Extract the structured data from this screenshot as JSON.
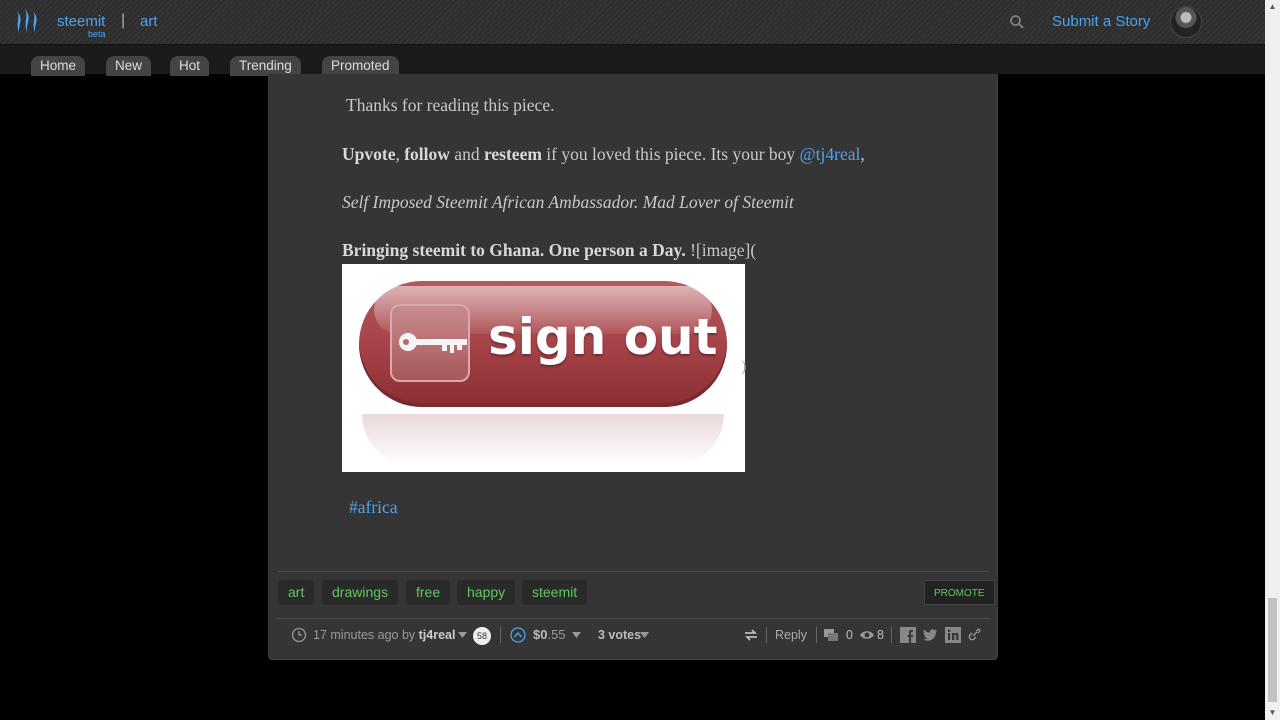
{
  "header": {
    "brand": "steemit",
    "brand_beta": "beta",
    "separator": "|",
    "section": "art",
    "submit_label": "Submit a Story"
  },
  "nav": {
    "tabs": [
      "Home",
      "New",
      "Hot",
      "Trending",
      "Promoted"
    ]
  },
  "post": {
    "line1": "Thanks for reading this piece.",
    "line2_upvote": "Upvote",
    "line2_comma1": ", ",
    "line2_follow": "follow",
    "line2_and": " and ",
    "line2_resteem": "resteem",
    "line2_rest": " if you loved this piece.  Its your boy ",
    "line2_mention": "@tj4real",
    "line2_end": ",",
    "line3": "Self Imposed Steemit African Ambassador. Mad Lover of Steemit",
    "line4_bold": "Bringing steemit to Ghana. One person a Day.",
    "line4_rest": "   ![image](",
    "image_text": "sign out",
    "paren_close": ")",
    "hashtag": "#africa"
  },
  "tags": [
    "art",
    "drawings",
    "free",
    "happy",
    "steemit"
  ],
  "promote_label": "PROMOTE",
  "footer": {
    "time": "17 minutes ago by ",
    "author": "tj4real",
    "reputation": "58",
    "payout_symbol": "$",
    "payout_bold": "0",
    "payout_rest": ".55",
    "votes": "3 votes",
    "reply": "Reply",
    "comments": "0",
    "views": "8"
  },
  "colors": {
    "accent": "#4ba2f2",
    "tag_green": "#5ec95e",
    "card_bg": "#353535"
  }
}
